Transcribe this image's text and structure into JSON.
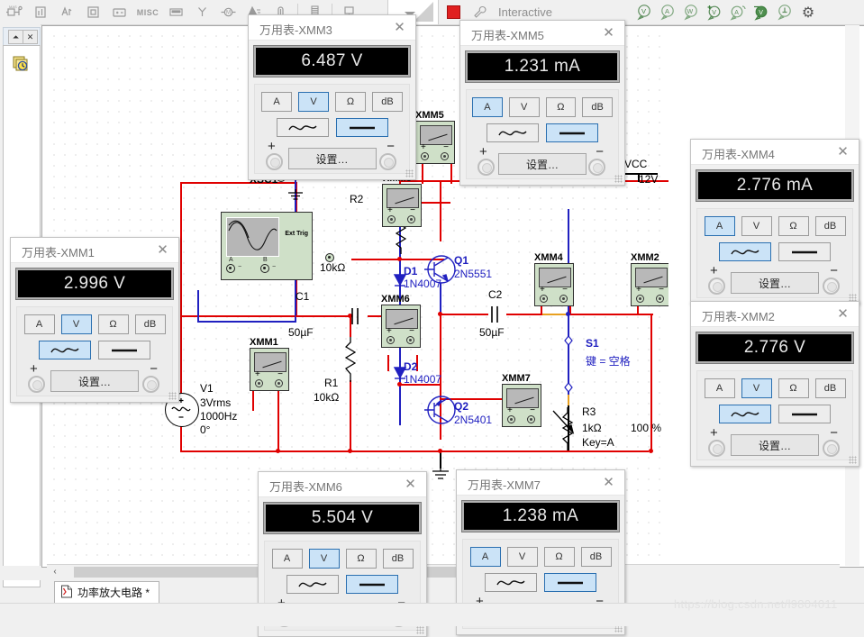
{
  "toolbar": {
    "left_icons": [
      "component-icon",
      "place-analog-icon",
      "place-transistor-icon",
      "place-ic-icon",
      "place-battery-icon",
      "misc-icon",
      "place-connector-icon",
      "place-antenna-icon",
      "place-machine-icon",
      "place-bus-icon",
      "place-probe-icon",
      "place-ladder-icon",
      "place-hierarchy-icon"
    ],
    "misc_label": "MISC",
    "simulation": {
      "pause_label": "❚❚",
      "stop_label": "stop",
      "profile_label": "Interactive",
      "wrench_icon": "wrench-icon"
    },
    "probes": [
      {
        "name": "probe-voltage",
        "glyph": "V"
      },
      {
        "name": "probe-current",
        "glyph": "A"
      },
      {
        "name": "probe-power",
        "glyph": "W"
      },
      {
        "name": "probe-differential-voltage",
        "glyph": "V"
      },
      {
        "name": "probe-differential-current",
        "glyph": "A"
      },
      {
        "name": "probe-reference-voltage",
        "glyph": "V"
      },
      {
        "name": "probe-digital",
        "glyph": "⏏"
      }
    ],
    "settings_label": "⚙"
  },
  "left_dock": {
    "pin_label": "⏶",
    "close_label": "✕",
    "layers_icon": "layers-clock-icon"
  },
  "canvas": {
    "scroll_left_label": "‹"
  },
  "schematic": {
    "instruments": [
      {
        "ref": "XSC1",
        "type": "oscilloscope",
        "ext_trig": "Ext Trig",
        "terminals": [
          {
            "label": "A"
          },
          {
            "label": "B"
          }
        ]
      },
      {
        "ref": "XMM5",
        "type": "multimeter-symbol"
      },
      {
        "ref": "XMM3",
        "type": "multimeter-symbol"
      },
      {
        "ref": "XMM6",
        "type": "multimeter-symbol"
      },
      {
        "ref": "XMM1",
        "type": "multimeter-symbol"
      },
      {
        "ref": "XMM4",
        "type": "multimeter-symbol"
      },
      {
        "ref": "XMM2",
        "type": "multimeter-symbol"
      },
      {
        "ref": "XMM7",
        "type": "multimeter-symbol"
      }
    ],
    "components": [
      {
        "ref": "R2",
        "value": "10kΩ",
        "type": "resistor"
      },
      {
        "ref": "R1",
        "value": "10kΩ",
        "type": "resistor"
      },
      {
        "ref": "R3",
        "value": "1kΩ",
        "key": "Key=A",
        "percent": "100 %",
        "type": "potentiometer"
      },
      {
        "ref": "C1",
        "value": "50µF",
        "type": "capacitor"
      },
      {
        "ref": "C2",
        "value": "50µF",
        "type": "capacitor"
      },
      {
        "ref": "D1",
        "value": "1N4007",
        "type": "diode"
      },
      {
        "ref": "D2",
        "value": "1N4007",
        "type": "diode"
      },
      {
        "ref": "Q1",
        "value": "2N5551",
        "type": "npn-transistor"
      },
      {
        "ref": "Q2",
        "value": "2N5401",
        "type": "pnp-transistor"
      },
      {
        "ref": "S1",
        "value": "键 = 空格",
        "type": "switch"
      },
      {
        "ref": "V1",
        "value_lines": [
          "3Vrms",
          "1000Hz",
          "0°"
        ],
        "type": "ac-source"
      }
    ],
    "power": {
      "label": "VCC",
      "value": "12V"
    },
    "ground": {
      "name": "ground-symbol"
    }
  },
  "multimeters": [
    {
      "id": "XMM3",
      "title": "万用表-XMM3",
      "reading": "6.487 V",
      "modes": [
        "A",
        "V",
        "Ω",
        "dB"
      ],
      "active_mode": "V",
      "coupling": [
        "ac",
        "dc"
      ],
      "active_coupling": "dc",
      "settings_label": "设置…",
      "plus": "+",
      "minus": "−",
      "close": "✕"
    },
    {
      "id": "XMM5",
      "title": "万用表-XMM5",
      "reading": "1.231 mA",
      "modes": [
        "A",
        "V",
        "Ω",
        "dB"
      ],
      "active_mode": "A",
      "coupling": [
        "ac",
        "dc"
      ],
      "active_coupling": "dc",
      "settings_label": "设置…",
      "plus": "+",
      "minus": "−",
      "close": "✕"
    },
    {
      "id": "XMM4",
      "title": "万用表-XMM4",
      "reading": "2.776 mA",
      "modes": [
        "A",
        "V",
        "Ω",
        "dB"
      ],
      "active_mode": "A",
      "coupling": [
        "ac",
        "dc"
      ],
      "active_coupling": "ac",
      "settings_label": "设置…",
      "plus": "+",
      "minus": "−",
      "close": "✕"
    },
    {
      "id": "XMM1",
      "title": "万用表-XMM1",
      "reading": "2.996 V",
      "modes": [
        "A",
        "V",
        "Ω",
        "dB"
      ],
      "active_mode": "V",
      "coupling": [
        "ac",
        "dc"
      ],
      "active_coupling": "ac",
      "settings_label": "设置…",
      "plus": "+",
      "minus": "−",
      "close": "✕"
    },
    {
      "id": "XMM2",
      "title": "万用表-XMM2",
      "reading": "2.776 V",
      "modes": [
        "A",
        "V",
        "Ω",
        "dB"
      ],
      "active_mode": "V",
      "coupling": [
        "ac",
        "dc"
      ],
      "active_coupling": "ac",
      "settings_label": "设置…",
      "plus": "+",
      "minus": "−",
      "close": "✕"
    },
    {
      "id": "XMM6",
      "title": "万用表-XMM6",
      "reading": "5.504 V",
      "modes": [
        "A",
        "V",
        "Ω",
        "dB"
      ],
      "active_mode": "V",
      "coupling": [
        "ac",
        "dc"
      ],
      "active_coupling": "dc",
      "settings_label": "设置…",
      "plus": "+",
      "minus": "−",
      "close": "✕"
    },
    {
      "id": "XMM7",
      "title": "万用表-XMM7",
      "reading": "1.238 mA",
      "modes": [
        "A",
        "V",
        "Ω",
        "dB"
      ],
      "active_mode": "A",
      "coupling": [
        "ac",
        "dc"
      ],
      "active_coupling": "dc",
      "settings_label": "设置…",
      "plus": "+",
      "minus": "−",
      "close": "✕"
    }
  ],
  "sheet_tab": {
    "label": "功率放大电路 *",
    "icon": "schematic-file-icon"
  },
  "watermark": "https://blog.csdn.net/l9804011"
}
